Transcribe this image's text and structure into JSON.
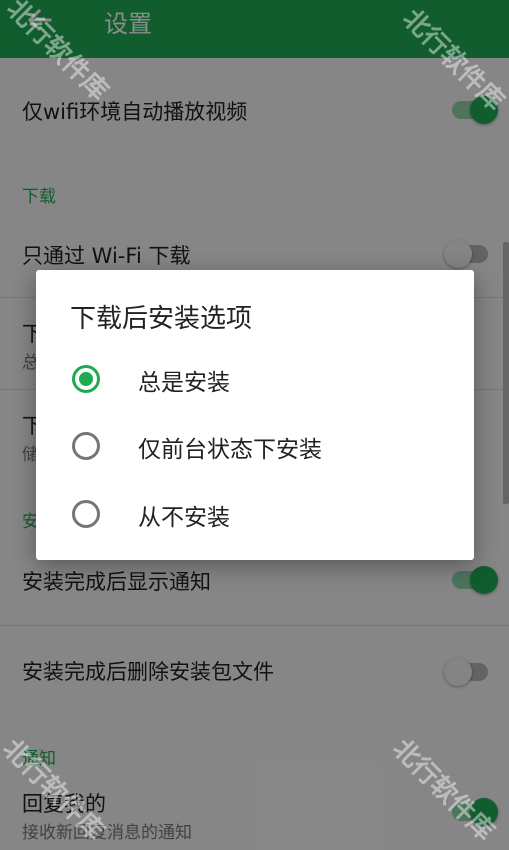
{
  "appbar": {
    "title": "设置",
    "back_icon": "arrow-left-icon"
  },
  "settings": {
    "wifi_autoplay": {
      "label": "仅wifi环境自动播放视频",
      "enabled": true
    },
    "section_download": "下载",
    "wifi_download": {
      "label": "只通过 Wi-Fi 下载",
      "enabled": false
    },
    "row_partial_1": {
      "label": "下",
      "sub": "总"
    },
    "row_partial_2": {
      "label": "下",
      "sub": "储"
    },
    "section_install_partial": "安",
    "install_notify": {
      "label": "安装完成后显示通知",
      "enabled": true
    },
    "delete_package": {
      "label": "安装完成后删除安装包文件",
      "enabled": false
    },
    "section_notify": "通知",
    "reply_me": {
      "label": "回复我的",
      "sub": "接收新回复消息的通知",
      "enabled": true
    }
  },
  "dialog": {
    "title": "下载后安装选项",
    "options": [
      {
        "label": "总是安装",
        "checked": true
      },
      {
        "label": "仅前台状态下安装",
        "checked": false
      },
      {
        "label": "从不安装",
        "checked": false
      }
    ]
  },
  "watermark": "北行软件库",
  "colors": {
    "accent": "#1faa52",
    "scrim": "rgba(0,0,0,0.45)"
  }
}
